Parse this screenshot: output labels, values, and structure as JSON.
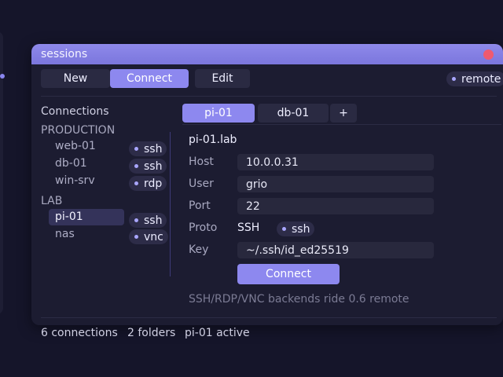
{
  "window": {
    "title": "sessions"
  },
  "toolbar": {
    "new_label": "New",
    "connect_label": "Connect",
    "edit_label": "Edit",
    "remote_tag": "remote"
  },
  "sidebar": {
    "header": "Connections",
    "groups": [
      {
        "name": "PRODUCTION",
        "items": [
          {
            "label": "web-01",
            "proto": "ssh"
          },
          {
            "label": "db-01",
            "proto": "ssh"
          },
          {
            "label": "win-srv",
            "proto": "rdp"
          }
        ]
      },
      {
        "name": "LAB",
        "items": [
          {
            "label": "pi-01",
            "proto": "ssh",
            "selected": true
          },
          {
            "label": "nas",
            "proto": "vnc"
          }
        ]
      }
    ]
  },
  "tabs": [
    {
      "label": "pi-01",
      "active": true
    },
    {
      "label": "db-01",
      "active": false
    },
    {
      "label": "+",
      "active": false
    }
  ],
  "detail": {
    "host_title": "pi-01.lab",
    "fields": {
      "host": {
        "label": "Host",
        "value": "10.0.0.31"
      },
      "user": {
        "label": "User",
        "value": "grio"
      },
      "port": {
        "label": "Port",
        "value": "22"
      },
      "proto": {
        "label": "Proto",
        "value": "SSH",
        "tag": "ssh"
      },
      "key": {
        "label": "Key",
        "value": "~/.ssh/id_ed25519"
      }
    },
    "connect_label": "Connect",
    "note": "SSH/RDP/VNC backends ride 0.6 remote"
  },
  "status": {
    "connections": "6 connections",
    "folders": "2 folders",
    "active": "pi-01 active"
  },
  "colors": {
    "accent": "#8d88ef",
    "close": "#ef5a6f",
    "background": "#15152a",
    "window": "#1c1c31"
  }
}
